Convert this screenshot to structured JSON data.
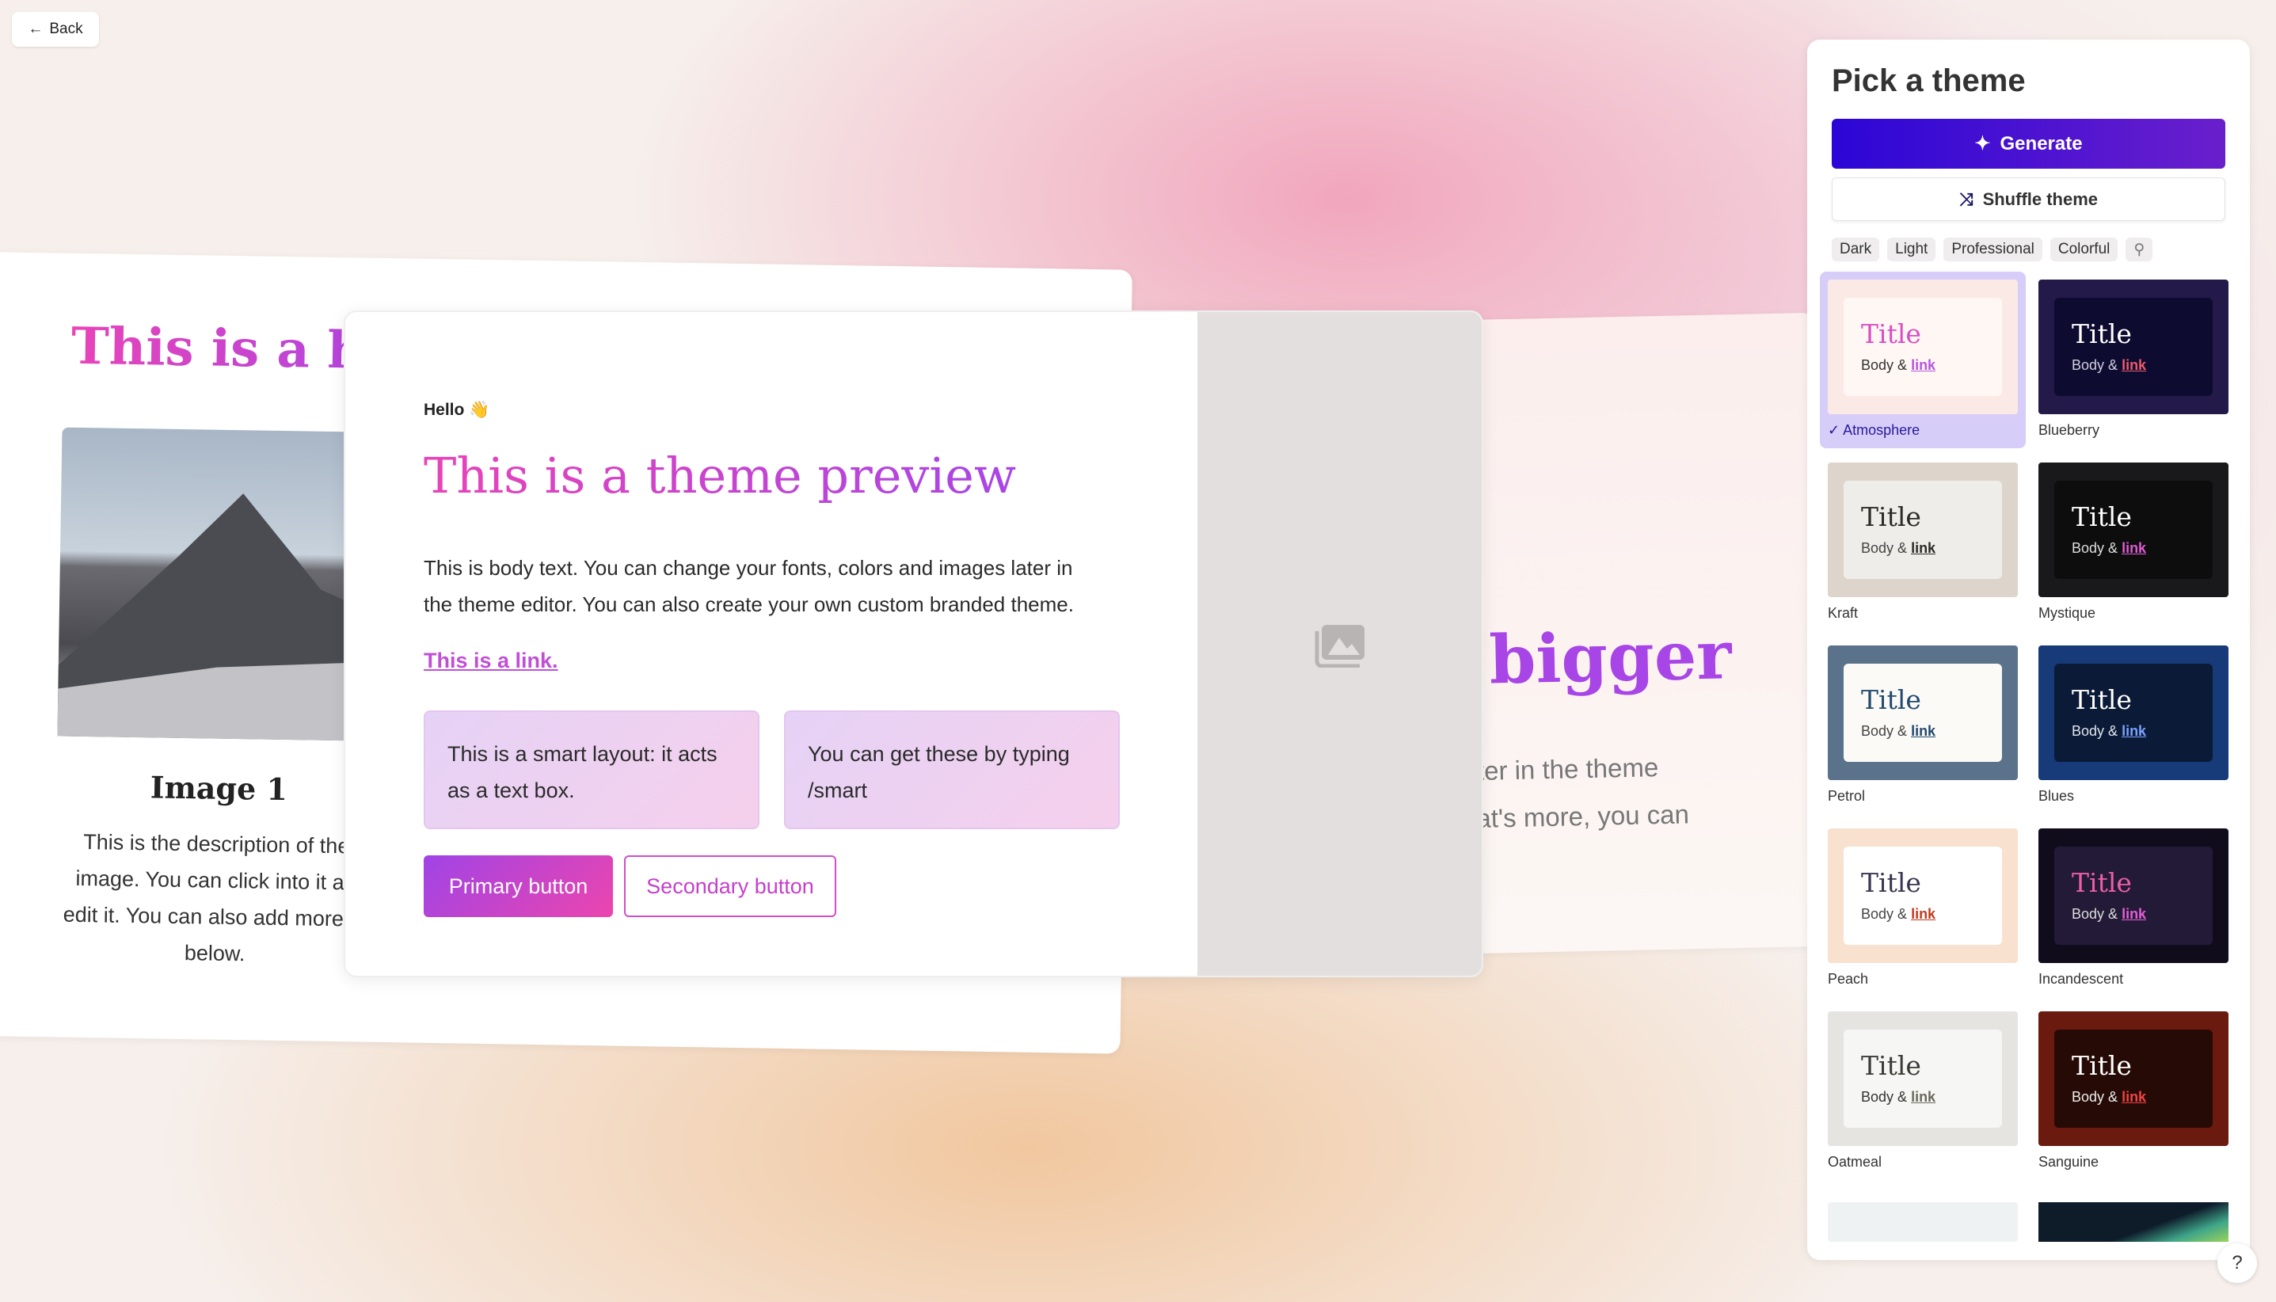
{
  "back_label": "Back",
  "left_slide": {
    "heading": "This is a hea",
    "image_title": "Image 1",
    "description": [
      "This is the description of the",
      "image. You can click into it an",
      "edit it. You can also add more te",
      "below."
    ]
  },
  "right_slide": {
    "heading": "bigger",
    "body": [
      "s later in the theme",
      "What's more, you can"
    ]
  },
  "preview": {
    "hello": "Hello 👋",
    "title": "This is a theme preview",
    "body": "This is body text. You can change your fonts, colors and images later in the theme editor. You can also create your own custom branded theme.",
    "link": "This is a link.",
    "box1": "This is a smart layout: it acts as a text box.",
    "box2": "You can get these by typing /smart",
    "primary": "Primary button",
    "secondary": "Secondary button"
  },
  "panel": {
    "title": "Pick a theme",
    "generate": "Generate",
    "shuffle": "Shuffle theme",
    "filters": [
      "Dark",
      "Light",
      "Professional",
      "Colorful"
    ],
    "selected_theme": "Atmosphere",
    "themes": [
      {
        "name": "Atmosphere",
        "title": "Title",
        "body": "Body &",
        "link": "link",
        "bg": "#fbe9e6",
        "inner": "#fff7f3",
        "title_color": "#d94ec4",
        "text": "#333",
        "link_color": "#b755e0"
      },
      {
        "name": "Blueberry",
        "title": "Title",
        "body": "Body &",
        "link": "link",
        "bg": "#231a4a",
        "inner": "#0e0b30",
        "title_color": "#ffffff",
        "text": "#cfcde0",
        "link_color": "#ef5a6a"
      },
      {
        "name": "Kraft",
        "title": "Title",
        "body": "Body &",
        "link": "link",
        "bg": "#ddd5cc",
        "inner": "#efede9",
        "title_color": "#2c2a26",
        "text": "#444",
        "link_color": "#2c2a26"
      },
      {
        "name": "Mystique",
        "title": "Title",
        "body": "Body &",
        "link": "link",
        "bg": "#19181b",
        "inner": "#0d0d0e",
        "title_color": "#ffffff",
        "text": "#ddd",
        "link_color": "#e05bd5"
      },
      {
        "name": "Petrol",
        "title": "Title",
        "body": "Body &",
        "link": "link",
        "bg": "#5a728a",
        "inner": "#fbfaf6",
        "title_color": "#234a6e",
        "text": "#444",
        "link_color": "#234a6e"
      },
      {
        "name": "Blues",
        "title": "Title",
        "body": "Body &",
        "link": "link",
        "bg": "#173a78",
        "inner": "#0b1a36",
        "title_color": "#ffffff",
        "text": "#e0e6f0",
        "link_color": "#7aa2ff"
      },
      {
        "name": "Peach",
        "title": "Title",
        "body": "Body &",
        "link": "link",
        "bg": "#f8e2cf",
        "inner": "#ffffff",
        "title_color": "#3a3550",
        "text": "#444",
        "link_color": "#c33a1e"
      },
      {
        "name": "Incandescent",
        "title": "Title",
        "body": "Body &",
        "link": "link",
        "bg": "#100c1c",
        "inner": "#231a38",
        "title_color": "#ec5fa8",
        "text": "#ddd",
        "link_color": "#e060d6"
      },
      {
        "name": "Oatmeal",
        "title": "Title",
        "body": "Body &",
        "link": "link",
        "bg": "#e5e4e1",
        "inner": "#f6f6f4",
        "title_color": "#3a3a36",
        "text": "#333",
        "link_color": "#6a6a5a"
      },
      {
        "name": "Sanguine",
        "title": "Title",
        "body": "Body &",
        "link": "link",
        "bg": "#6a1a0e",
        "inner": "#260a06",
        "title_color": "#ffffff",
        "text": "#eee",
        "link_color": "#ef4444"
      }
    ]
  },
  "help_label": "?"
}
